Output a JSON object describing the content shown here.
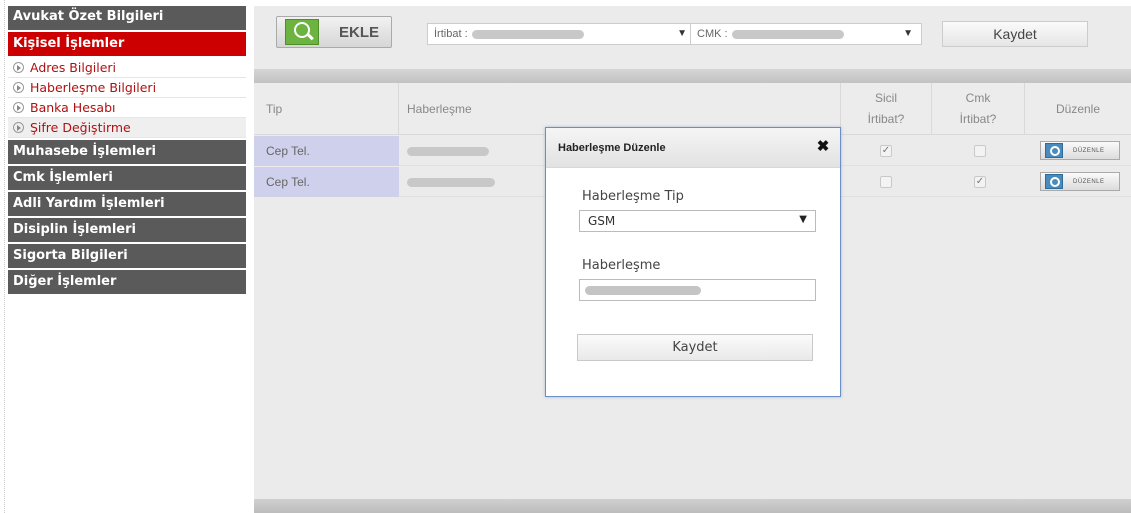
{
  "sidebar": {
    "summary": "Avukat Özet Bilgileri",
    "personal": "Kişisel İşlemler",
    "sub_items": [
      {
        "label": "Adres Bilgileri"
      },
      {
        "label": "Haberleşme Bilgileri"
      },
      {
        "label": "Banka Hesabı"
      },
      {
        "label": "Şifre Değiştirme"
      }
    ],
    "sections": [
      {
        "label": "Muhasebe İşlemleri"
      },
      {
        "label": "Cmk İşlemleri"
      },
      {
        "label": "Adli Yardım İşlemleri"
      },
      {
        "label": "Disiplin İşlemleri"
      },
      {
        "label": "Sigorta Bilgileri"
      },
      {
        "label": "Diğer İşlemler"
      }
    ],
    "active_color": "#cc0000",
    "link_color": "#b01010"
  },
  "toolbar": {
    "add_label": "EKLE",
    "irtibat_label": "İrtibat :",
    "cmk_label": "CMK :",
    "save_label": "Kaydet",
    "add_icon": "add-search-icon"
  },
  "grid": {
    "headers": {
      "tip": "Tip",
      "haberlesme": "Haberleşme",
      "sicil_1": "Sicil",
      "sicil_2": "İrtibat?",
      "cmk_1": "Cmk",
      "cmk_2": "İrtibat?",
      "duzenle": "Düzenle"
    },
    "rows": [
      {
        "tip": "Cep Tel.",
        "sicil_irtibat": true,
        "cmk_irtibat": false,
        "edit_label": "DÜZENLE"
      },
      {
        "tip": "Cep Tel.",
        "sicil_irtibat": false,
        "cmk_irtibat": true,
        "edit_label": "DÜZENLE"
      }
    ]
  },
  "modal": {
    "title": "Haberleşme Düzenle",
    "type_label": "Haberleşme Tip",
    "type_value": "GSM",
    "value_label": "Haberleşme",
    "save_label": "Kaydet",
    "border_color": "#6a8fc7"
  }
}
